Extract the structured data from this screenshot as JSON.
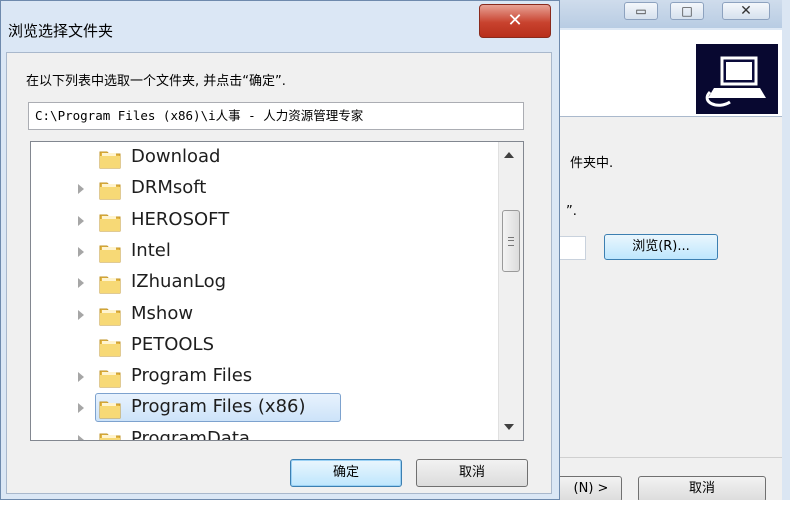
{
  "background_window": {
    "minimize_symbol": "▭",
    "maximize_symbol": "□",
    "close_symbol": "✕",
    "text_line1": "件夹中.",
    "text_line2": "”.",
    "browse_button": "浏览(R)...",
    "next_button": "(N) >",
    "cancel_button": "取消"
  },
  "dialog": {
    "title": "浏览选择文件夹",
    "close_symbol": "✕",
    "instruction": "在以下列表中选取一个文件夹, 并点击“确定”.",
    "path_value": "C:\\Program Files (x86)\\i人事 - 人力资源管理专家",
    "folders": [
      {
        "name": "Download",
        "has_children": false,
        "selected": false
      },
      {
        "name": "DRMsoft",
        "has_children": true,
        "selected": false
      },
      {
        "name": "HEROSOFT",
        "has_children": true,
        "selected": false
      },
      {
        "name": "Intel",
        "has_children": true,
        "selected": false
      },
      {
        "name": "IZhuanLog",
        "has_children": true,
        "selected": false
      },
      {
        "name": "Mshow",
        "has_children": true,
        "selected": false
      },
      {
        "name": "PETOOLS",
        "has_children": false,
        "selected": false
      },
      {
        "name": "Program Files",
        "has_children": true,
        "selected": false
      },
      {
        "name": "Program Files (x86)",
        "has_children": true,
        "selected": true
      },
      {
        "name": "ProgramData",
        "has_children": true,
        "selected": false
      }
    ],
    "ok_button": "确定",
    "cancel_button": "取消"
  },
  "icons": {
    "folder": "folder-icon",
    "expander": "expand-arrow-icon",
    "scroll_up": "scroll-up-arrow-icon",
    "scroll_down": "scroll-down-arrow-icon",
    "logo": "installer-logo-icon"
  },
  "colors": {
    "dialog_frame": "#dbe7f5",
    "close_button": "#c8422e",
    "selection": "#cde3f9",
    "folder_yellow": "#f2cf63"
  }
}
